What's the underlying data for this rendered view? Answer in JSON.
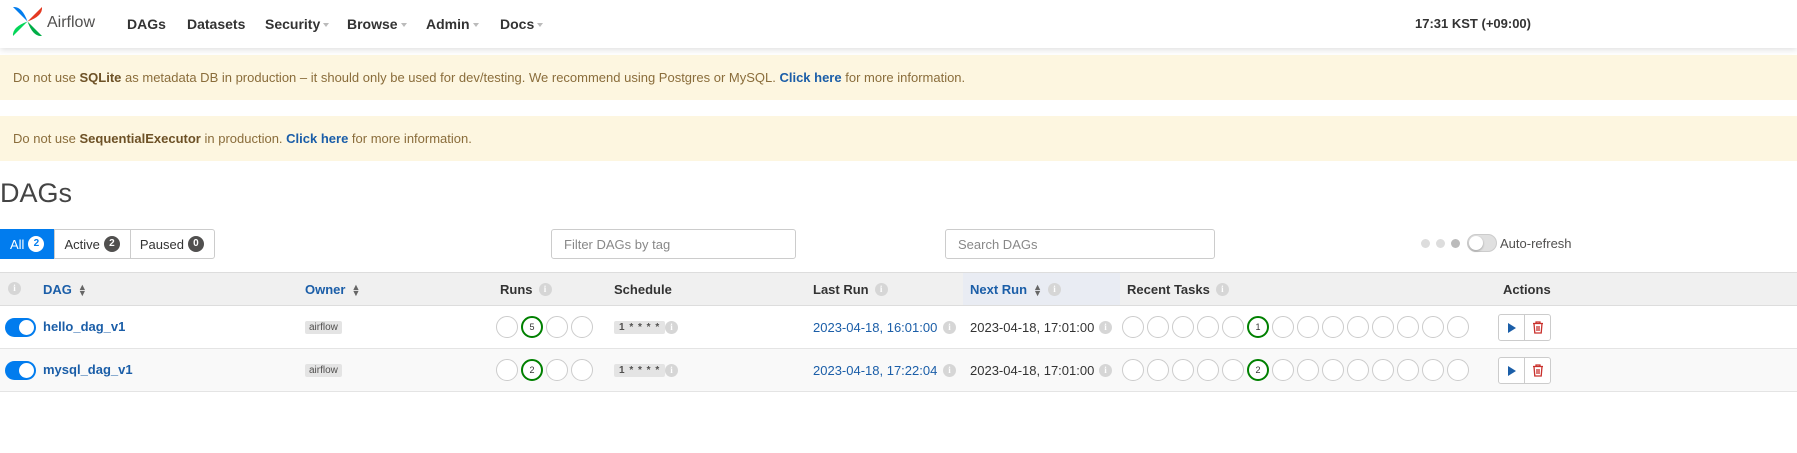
{
  "navbar": {
    "brand": "Airflow",
    "items": [
      {
        "label": "DAGs",
        "dropdown": false
      },
      {
        "label": "Datasets",
        "dropdown": false
      },
      {
        "label": "Security",
        "dropdown": true
      },
      {
        "label": "Browse",
        "dropdown": true
      },
      {
        "label": "Admin",
        "dropdown": true
      },
      {
        "label": "Docs",
        "dropdown": true
      }
    ],
    "clock": "17:31 KST (+09:00)"
  },
  "alerts": [
    {
      "pre": "Do not use ",
      "strong": "SQLite",
      "mid": " as metadata DB in production – it should only be used for dev/testing. We recommend using Postgres or MySQL. ",
      "link": "Click here",
      "post": " for more information."
    },
    {
      "pre": "Do not use ",
      "strong": "SequentialExecutor",
      "mid": " in production. ",
      "link": "Click here",
      "post": " for more information."
    }
  ],
  "page_title": "DAGs",
  "status_filter": [
    {
      "label": "All",
      "count": "2"
    },
    {
      "label": "Active",
      "count": "2"
    },
    {
      "label": "Paused",
      "count": "0"
    }
  ],
  "tag_filter_placeholder": "Filter DAGs by tag",
  "search_placeholder": "Search DAGs",
  "auto_refresh_label": "Auto-refresh",
  "table": {
    "headers": {
      "dag": "DAG",
      "owner": "Owner",
      "runs": "Runs",
      "schedule": "Schedule",
      "last_run": "Last Run",
      "next_run": "Next Run",
      "recent_tasks": "Recent Tasks",
      "actions": "Actions"
    },
    "rows": [
      {
        "dag_id": "hello_dag_v1",
        "owner": "airflow",
        "schedule": "1 * * * *",
        "last_run": "2023-04-18, 16:01:00",
        "next_run": "2023-04-18, 17:01:00",
        "runs": [
          "",
          "5",
          "",
          ""
        ],
        "tasks": [
          "",
          "",
          "",
          "",
          "",
          "1",
          "",
          "",
          "",
          "",
          "",
          "",
          "",
          ""
        ]
      },
      {
        "dag_id": "mysql_dag_v1",
        "owner": "airflow",
        "schedule": "1 * * * *",
        "last_run": "2023-04-18, 17:22:04",
        "next_run": "2023-04-18, 17:01:00",
        "runs": [
          "",
          "2",
          "",
          ""
        ],
        "tasks": [
          "",
          "",
          "",
          "",
          "",
          "2",
          "",
          "",
          "",
          "",
          "",
          "",
          "",
          ""
        ]
      }
    ]
  },
  "colors": {
    "primary": "#017cee",
    "link": "#1b5ea8",
    "success": "#008000",
    "danger": "#c9302c",
    "alert_bg": "#fdf6e0"
  }
}
